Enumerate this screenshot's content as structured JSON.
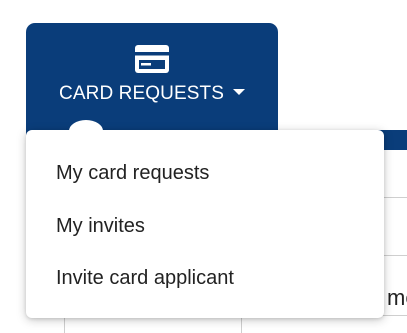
{
  "tab": {
    "label": "CARD REQUESTS",
    "icon": "credit-card-icon",
    "caret_icon": "caret-down-icon"
  },
  "menu": {
    "items": [
      {
        "label": "My card requests"
      },
      {
        "label": "My invites"
      },
      {
        "label": "Invite card applicant"
      }
    ]
  },
  "background": {
    "partial_cell_text": "me"
  },
  "colors": {
    "brand_navy": "#0a3d7a",
    "menu_background": "#ffffff",
    "menu_text": "#222222",
    "grid_line": "#cfcfcf"
  }
}
